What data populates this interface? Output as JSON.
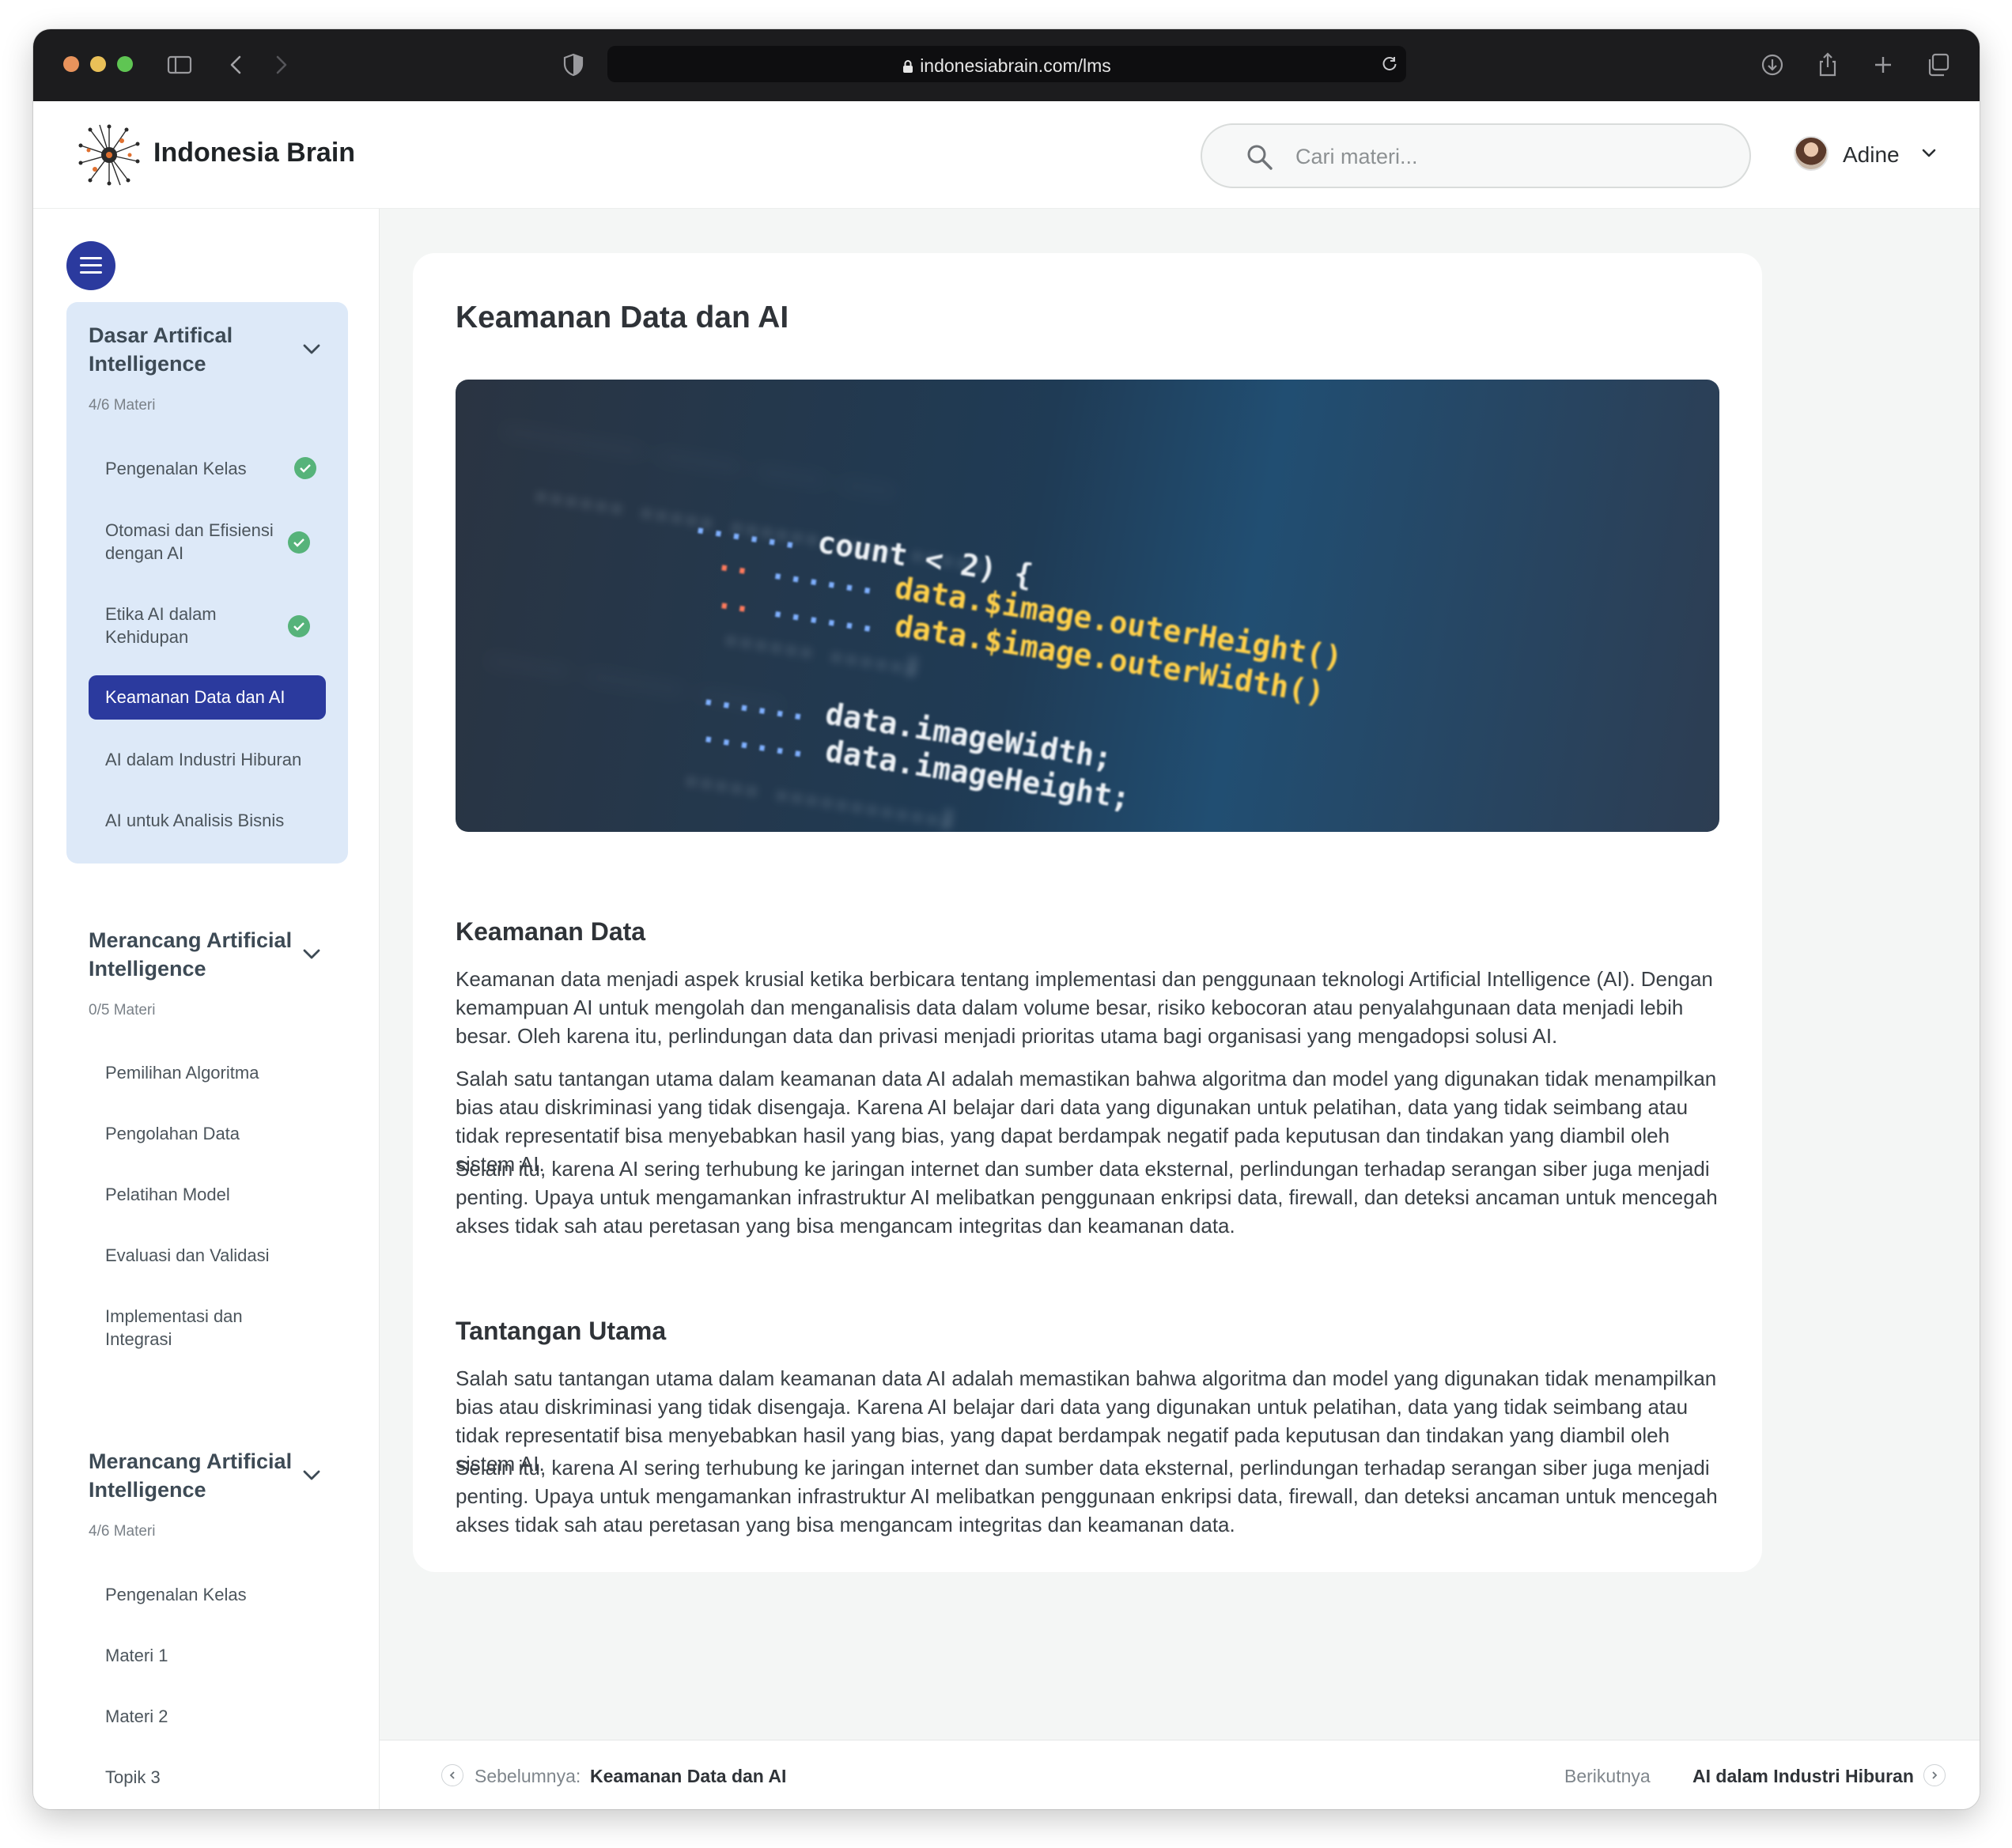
{
  "browser": {
    "url": "indonesiabrain.com/lms"
  },
  "header": {
    "brand": "Indonesia Brain",
    "search_placeholder": "Cari materi...",
    "user_name": "Adine"
  },
  "sidebar": {
    "sections": [
      {
        "title": "Dasar Artifical Intelligence",
        "count": "4/6 Materi",
        "items": [
          {
            "label": "Pengenalan Kelas",
            "done": true
          },
          {
            "label": "Otomasi dan Efisiensi dengan AI",
            "done": true
          },
          {
            "label": "Etika AI dalam Kehidupan",
            "done": true
          },
          {
            "label": "Keamanan Data dan AI",
            "current": true
          },
          {
            "label": "AI dalam Industri Hiburan"
          },
          {
            "label": "AI untuk Analisis Bisnis"
          }
        ]
      },
      {
        "title": "Merancang Artificial Intelligence",
        "count": "0/5 Materi",
        "items": [
          {
            "label": "Pemilihan Algoritma"
          },
          {
            "label": "Pengolahan Data"
          },
          {
            "label": "Pelatihan Model"
          },
          {
            "label": "Evaluasi dan Validasi"
          },
          {
            "label": "Implementasi dan Integrasi"
          }
        ]
      },
      {
        "title": "Merancang Artificial Intelligence",
        "count": "4/6 Materi",
        "items": [
          {
            "label": "Pengenalan Kelas"
          },
          {
            "label": "Materi 1"
          },
          {
            "label": "Materi 2"
          },
          {
            "label": "Topik 3"
          }
        ]
      }
    ]
  },
  "content": {
    "title": "Keamanan Data dan AI",
    "hero_code": {
      "line1": "count < 2) {",
      "line2": "data.$image.outerHeight()",
      "line3": "data.$image.outerWidth()",
      "line4": "data.imageWidth;",
      "line5": "data.imageHeight;"
    },
    "sections": [
      {
        "heading": "Keamanan Data",
        "paragraphs": [
          "Keamanan data menjadi aspek krusial ketika berbicara tentang implementasi dan penggunaan teknologi Artificial Intelligence (AI). Dengan kemampuan AI untuk mengolah dan menganalisis data dalam volume besar, risiko kebocoran atau penyalahgunaan data menjadi lebih besar. Oleh karena itu, perlindungan data dan privasi menjadi prioritas utama bagi organisasi yang mengadopsi solusi AI.",
          "Salah satu tantangan utama dalam keamanan data AI adalah memastikan bahwa algoritma dan model yang digunakan tidak menampilkan bias atau diskriminasi yang tidak disengaja. Karena AI belajar dari data yang digunakan untuk pelatihan, data yang tidak seimbang atau tidak representatif bisa menyebabkan hasil yang bias, yang dapat berdampak negatif pada keputusan dan tindakan yang diambil oleh sistem AI.",
          "Selain itu, karena AI sering terhubung ke jaringan internet dan sumber data eksternal, perlindungan terhadap serangan siber juga menjadi penting. Upaya untuk mengamankan infrastruktur AI melibatkan penggunaan enkripsi data, firewall, dan deteksi ancaman untuk mencegah akses tidak sah atau peretasan yang bisa mengancam integritas dan keamanan data."
        ]
      },
      {
        "heading": "Tantangan Utama",
        "paragraphs": [
          "Salah satu tantangan utama dalam keamanan data AI adalah memastikan bahwa algoritma dan model yang digunakan tidak menampilkan bias atau diskriminasi yang tidak disengaja. Karena AI belajar dari data yang digunakan untuk pelatihan, data yang tidak seimbang atau tidak representatif bisa menyebabkan hasil yang bias, yang dapat berdampak negatif pada keputusan dan tindakan yang diambil oleh sistem AI.",
          "Selain itu, karena AI sering terhubung ke jaringan internet dan sumber data eksternal, perlindungan terhadap serangan siber juga menjadi penting. Upaya untuk mengamankan infrastruktur AI melibatkan penggunaan enkripsi data, firewall, dan deteksi ancaman untuk mencegah akses tidak sah atau peretasan yang bisa mengancam integritas dan keamanan data."
        ]
      }
    ]
  },
  "footer": {
    "prev_label": "Sebelumnya:",
    "prev_target": "Keamanan Data dan AI",
    "next_label": "Berikutnya",
    "next_target": "AI dalam Industri Hiburan"
  },
  "colors": {
    "accent": "#2b3a9e",
    "active_section_bg": "#dde9f8",
    "done_check": "#56b37a"
  },
  "icons": {
    "logo": "neural-burst-logo",
    "search": "magnifier-icon",
    "check": "check-circle-icon"
  }
}
